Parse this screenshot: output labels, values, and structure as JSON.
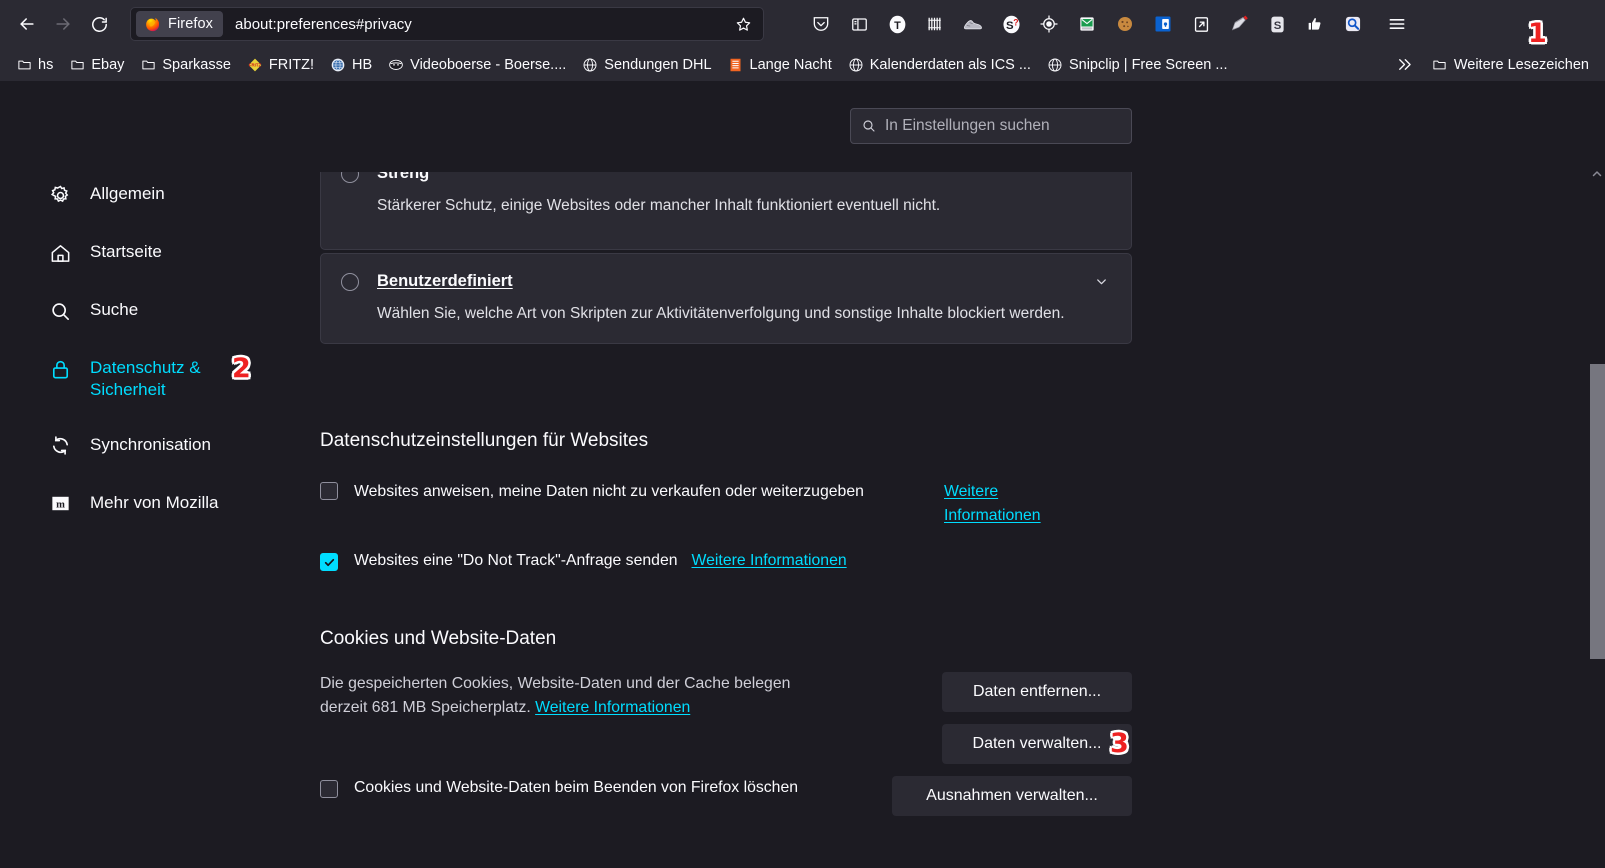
{
  "window": {
    "nav": {
      "back_icon": "arrow-left-icon",
      "forward_icon": "arrow-right-icon",
      "reload_icon": "reload-icon"
    },
    "urlbar": {
      "identity_chip_label": "Firefox",
      "identity_chip_icon": "firefox-logo-icon",
      "url": "about:preferences#privacy",
      "bookmark_star_icon": "star-icon"
    },
    "toolbar_icons": [
      {
        "name": "pocket-icon",
        "glyph": "shield-chevron"
      },
      {
        "name": "sidebar-icon",
        "glyph": "sidebar"
      },
      {
        "name": "extension-t-icon",
        "glyph": "T"
      },
      {
        "name": "extension-barcode-icon",
        "glyph": "bars"
      },
      {
        "name": "extension-shoe-icon",
        "glyph": "shoe"
      },
      {
        "name": "extension-ghostery-icon",
        "glyph": "S?"
      },
      {
        "name": "extension-target-icon",
        "glyph": "target"
      },
      {
        "name": "extension-mail-icon",
        "glyph": "mail"
      },
      {
        "name": "extension-cookie-icon",
        "glyph": "cookie"
      },
      {
        "name": "extension-lockwise-icon",
        "glyph": "lock-card"
      },
      {
        "name": "extension-popout-icon",
        "glyph": "popout"
      },
      {
        "name": "extension-paint-icon",
        "glyph": "paint"
      },
      {
        "name": "extension-s-icon",
        "glyph": "S"
      },
      {
        "name": "extension-thumb-icon",
        "glyph": "thumb"
      },
      {
        "name": "extension-search-blue-icon",
        "glyph": "magnifier"
      },
      {
        "name": "app-menu-icon",
        "glyph": "hamburger"
      }
    ],
    "bookmarks": [
      {
        "label": "hs",
        "icon": "folder-icon"
      },
      {
        "label": "Ebay",
        "icon": "folder-icon"
      },
      {
        "label": "Sparkasse",
        "icon": "folder-icon"
      },
      {
        "label": "FRITZ!",
        "icon": "fritzbox-favicon"
      },
      {
        "label": "HB",
        "icon": "globe-blue-favicon"
      },
      {
        "label": "Videoboerse - Boerse....",
        "icon": "videoboerse-favicon"
      },
      {
        "label": "Sendungen DHL",
        "icon": "globe-favicon"
      },
      {
        "label": "Lange Nacht",
        "icon": "orange-favicon"
      },
      {
        "label": "Kalenderdaten als ICS ...",
        "icon": "globe-favicon"
      },
      {
        "label": "Snipclip | Free Screen ...",
        "icon": "globe-favicon"
      }
    ],
    "bookmarks_overflow_icon": "double-chevron-right-icon",
    "other_bookmarks": {
      "label": "Weitere Lesezeichen",
      "icon": "folder-icon"
    }
  },
  "page": {
    "search": {
      "placeholder": "In Einstellungen suchen",
      "icon": "search-icon"
    },
    "sidebar": {
      "items": [
        {
          "label": "Allgemein",
          "icon": "gear-icon",
          "selected": false
        },
        {
          "label": "Startseite",
          "icon": "home-icon",
          "selected": false
        },
        {
          "label": "Suche",
          "icon": "search-icon",
          "selected": false
        },
        {
          "label": "Datenschutz & Sicherheit",
          "icon": "lock-icon",
          "selected": true
        },
        {
          "label": "Synchronisation",
          "icon": "sync-icon",
          "selected": false
        },
        {
          "label": "Mehr von Mozilla",
          "icon": "mozilla-m-icon",
          "selected": false
        }
      ]
    },
    "tracking_protection": {
      "strict": {
        "title": "Streng",
        "description": "Stärkerer Schutz, einige Websites oder mancher Inhalt funktioniert eventuell nicht.",
        "selected": false
      },
      "custom": {
        "title": "Benutzerdefiniert",
        "title_accesskey": "B",
        "description": "Wählen Sie, welche Art von Skripten zur Aktivitätenverfolgung und sonstige Inhalte blockiert werden.",
        "selected": false,
        "expand_icon": "chevron-down-icon"
      }
    },
    "website_privacy": {
      "heading": "Datenschutzeinstellungen für Websites",
      "gpc": {
        "label": "Websites anweisen, meine Daten nicht zu verkaufen oder weiterzugeben",
        "checked": false,
        "learn_more": "Weitere Informationen"
      },
      "dnt": {
        "label": "Websites eine \"Do Not Track\"-Anfrage senden",
        "checked": true,
        "learn_more": "Weitere Informationen"
      }
    },
    "cookies": {
      "heading": "Cookies und Website-Daten",
      "description_part1": "Die gespeicherten Cookies, Website-Daten und der Cache belegen derzeit 681 MB Speicherplatz.",
      "storage_size": "681 MB",
      "learn_more": "Weitere Informationen",
      "clear_on_close": {
        "label": "Cookies und Website-Daten beim Beenden von Firefox löschen",
        "checked": false
      },
      "buttons": [
        {
          "label": "Daten entfernen...",
          "accesskey": "e"
        },
        {
          "label": "Daten verwalten...",
          "accesskey": "v"
        },
        {
          "label": "Ausnahmen verwalten...",
          "accesskey": "u"
        }
      ]
    },
    "annotations": [
      {
        "number": "1",
        "target": "app-menu-icon"
      },
      {
        "number": "2",
        "target": "sidebar-item-datenschutz"
      },
      {
        "number": "3",
        "target": "manage-data-button"
      }
    ]
  },
  "colors": {
    "accent": "#00ddff",
    "chrome_bg": "#2b2a33",
    "page_bg": "#1c1b22",
    "text": "#fbfbfe",
    "annotation_red": "#ee2222"
  }
}
